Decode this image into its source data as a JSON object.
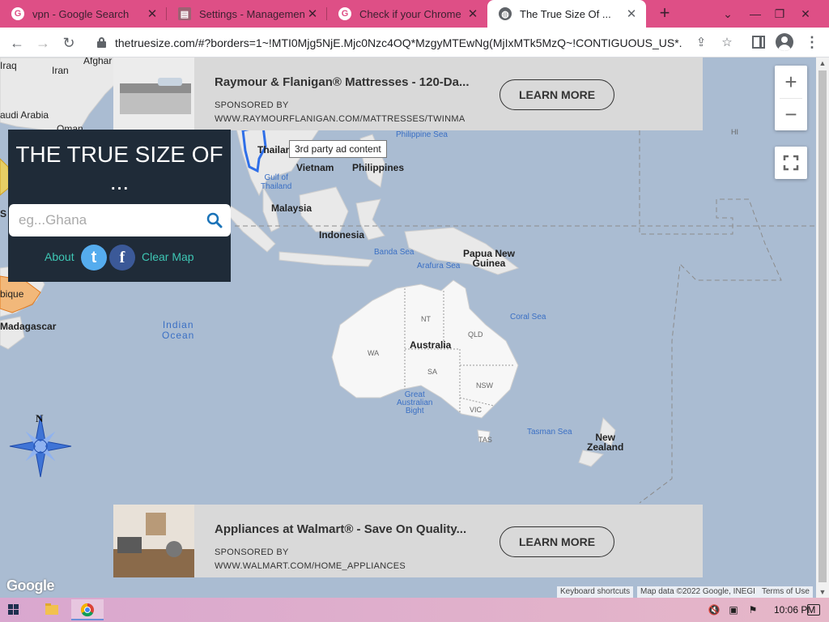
{
  "browser": {
    "tabs": [
      {
        "title": "vpn - Google Search",
        "icon": "google-icon",
        "active": false
      },
      {
        "title": "Settings - Management",
        "icon": "settings-icon",
        "active": false
      },
      {
        "title": "Check if your Chrome br",
        "icon": "google-icon",
        "active": false
      },
      {
        "title": "The True Size Of ...",
        "icon": "globe-icon",
        "active": true
      }
    ],
    "url": "thetruesize.com/#?borders=1~!MTI0Mjg5NjE.Mjc0Nzc4OQ*MzgyMTEwNg(MjIxMTk5MzQ~!CONTIGUOUS_US*...",
    "new_tab_symbol": "+",
    "accent_color": "#de4f86"
  },
  "true_size": {
    "title": "THE TRUE SIZE OF ...",
    "search_placeholder": "eg...Ghana",
    "about_label": "About",
    "twitter_label": "t",
    "facebook_label": "f",
    "clear_label": "Clear Map"
  },
  "ads": {
    "top": {
      "title": "Raymour & Flanigan® Mattresses - 120-Da...",
      "sponsored": "SPONSORED BY",
      "url": "WWW.RAYMOURFLANIGAN.COM/MATTRESSES/TWINMA",
      "button": "LEARN MORE"
    },
    "bottom": {
      "title": "Appliances at Walmart® - Save On Quality...",
      "sponsored": "SPONSORED BY",
      "url": "WWW.WALMART.COM/HOME_APPLIANCES",
      "button": "LEARN MORE"
    },
    "tooltip": "3rd party ad content"
  },
  "map": {
    "labels": {
      "iraq": "Iraq",
      "iran": "Iran",
      "afghan": "Afghar",
      "saudi": "audi Arabia",
      "oman": "Oman",
      "thailand": "Thailan",
      "vietnam": "Vietnam",
      "philippines": "Philippines",
      "philippine_sea": "Philippine Sea",
      "gulf_thailand": "Gulf of\nThailand",
      "malaysia": "Malaysia",
      "indonesia": "Indonesia",
      "banda_sea": "Banda Sea",
      "arafura_sea": "Arafura Sea",
      "png": "Papua New\nGuinea",
      "indian_ocean": "Indian\nOcean",
      "coral_sea": "Coral Sea",
      "australia": "Australia",
      "nt": "NT",
      "qld": "QLD",
      "wa": "WA",
      "sa": "SA",
      "nsw": "NSW",
      "vic": "VIC",
      "tas": "TAS",
      "great_bight": "Great\nAustralian\nBight",
      "tasman_sea": "Tasman Sea",
      "new_zealand": "New\nZealand",
      "madagascar": "Madagascar",
      "mozambique": "bique",
      "hi": "HI",
      "s_frag": "S"
    },
    "zoom_in": "+",
    "zoom_out": "−",
    "google": "Google",
    "attribution": {
      "shortcuts": "Keyboard shortcuts",
      "data": "Map data ©2022 Google, INEGI",
      "terms": "Terms of Use"
    }
  },
  "taskbar": {
    "clock": "10:06 PM"
  }
}
